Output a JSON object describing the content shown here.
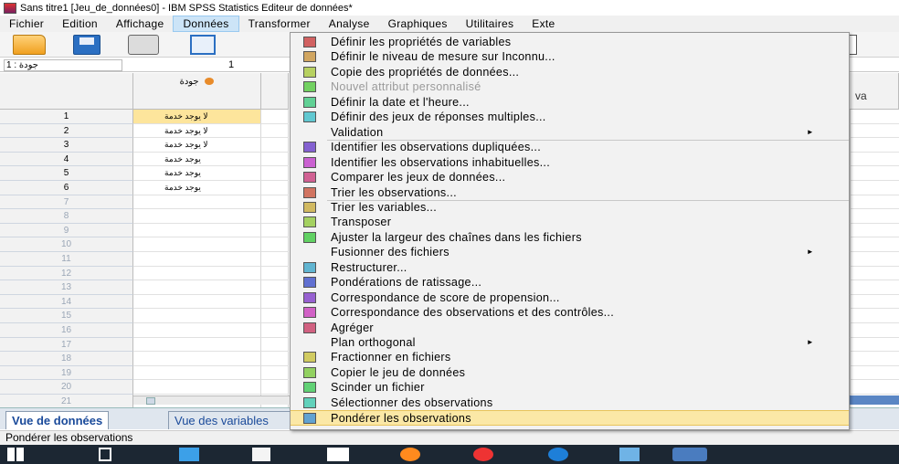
{
  "window": {
    "title": "Sans titre1 [Jeu_de_données0] - IBM SPSS Statistics Editeur de données*"
  },
  "menubar": {
    "items": [
      "Fichier",
      "Edition",
      "Affichage",
      "Données",
      "Transformer",
      "Analyse",
      "Graphiques",
      "Utilitaires",
      "Exte"
    ],
    "active": "Données"
  },
  "refbar": {
    "cell_ref": "جودة : 1",
    "cell_value": "1"
  },
  "grid": {
    "column_header": "جودة",
    "right_column_header": "va",
    "row_numbers": [
      "1",
      "2",
      "3",
      "4",
      "5",
      "6",
      "7",
      "8",
      "9",
      "10",
      "11",
      "12",
      "13",
      "14",
      "15",
      "16",
      "17",
      "18",
      "19",
      "20",
      "21"
    ],
    "cells": [
      "لا يوجد خدمة",
      "لا يوجد خدمة",
      "لا يوجد خدمة",
      "يوجد خدمة",
      "يوجد خدمة",
      "يوجد خدمة"
    ]
  },
  "dropdown": {
    "items": [
      {
        "label": "Définir les propriétés de variables",
        "icon": "variable-properties-icon",
        "submenu": false,
        "disabled": false
      },
      {
        "label": "Définir le niveau de mesure sur Inconnu...",
        "icon": "measure-level-icon",
        "submenu": false,
        "disabled": false
      },
      {
        "label": "Copie des propriétés de données...",
        "icon": "copy-properties-icon",
        "submenu": false,
        "disabled": false
      },
      {
        "label": "Nouvel attribut personnalisé",
        "icon": "custom-attribute-icon",
        "submenu": false,
        "disabled": true
      },
      {
        "label": "Définir la date et l'heure...",
        "icon": "calendar-icon",
        "submenu": false,
        "disabled": false
      },
      {
        "label": "Définir des jeux de réponses multiples...",
        "icon": "multiple-response-icon",
        "submenu": false,
        "disabled": false
      },
      {
        "label": "Validation",
        "icon": "",
        "submenu": true,
        "disabled": false
      },
      {
        "label": "Identifier les observations dupliquées...",
        "icon": "duplicate-cases-icon",
        "submenu": false,
        "disabled": false
      },
      {
        "label": "Identifier les observations inhabituelles...",
        "icon": "unusual-cases-icon",
        "submenu": false,
        "disabled": false
      },
      {
        "label": "Comparer les jeux de données...",
        "icon": "compare-datasets-icon",
        "submenu": false,
        "disabled": false
      },
      {
        "label": "Trier les observations...",
        "icon": "sort-cases-icon",
        "submenu": false,
        "disabled": false
      },
      {
        "label": "Trier les variables...",
        "icon": "sort-variables-icon",
        "submenu": false,
        "disabled": false
      },
      {
        "label": "Transposer",
        "icon": "transpose-icon",
        "submenu": false,
        "disabled": false
      },
      {
        "label": "Ajuster la largeur des chaînes dans les fichiers",
        "icon": "string-width-icon",
        "submenu": false,
        "disabled": false
      },
      {
        "label": "Fusionner des fichiers",
        "icon": "",
        "submenu": true,
        "disabled": false
      },
      {
        "label": "Restructurer...",
        "icon": "restructure-icon",
        "submenu": false,
        "disabled": false
      },
      {
        "label": "Pondérations de ratissage...",
        "icon": "raking-weights-icon",
        "submenu": false,
        "disabled": false
      },
      {
        "label": "Correspondance de score de propension...",
        "icon": "propensity-score-icon",
        "submenu": false,
        "disabled": false
      },
      {
        "label": "Correspondance des observations et des contrôles...",
        "icon": "case-control-icon",
        "submenu": false,
        "disabled": false
      },
      {
        "label": "Agréger",
        "icon": "aggregate-icon",
        "submenu": false,
        "disabled": false
      },
      {
        "label": "Plan orthogonal",
        "icon": "",
        "submenu": true,
        "disabled": false
      },
      {
        "label": "Fractionner en fichiers",
        "icon": "split-files-icon",
        "submenu": false,
        "disabled": false
      },
      {
        "label": "Copier le jeu de données",
        "icon": "copy-dataset-icon",
        "submenu": false,
        "disabled": false
      },
      {
        "label": "Scinder un fichier",
        "icon": "split-file-icon",
        "submenu": false,
        "disabled": false
      },
      {
        "label": "Sélectionner des observations",
        "icon": "select-cases-icon",
        "submenu": false,
        "disabled": false
      },
      {
        "label": "Pondérer les observations",
        "icon": "weight-cases-icon",
        "submenu": false,
        "disabled": false,
        "highlighted": true
      }
    ],
    "submenu_arrow": "►"
  },
  "tabs": {
    "data_view": "Vue de données",
    "variable_view": "Vue des variables"
  },
  "statusbar": {
    "text": "Pondérer les observations"
  },
  "colors": {
    "highlight": "#fbe8a6",
    "selected_cell": "#fde59c",
    "menu_bg": "#f2f2f2",
    "taskbar": "#1c2733"
  }
}
